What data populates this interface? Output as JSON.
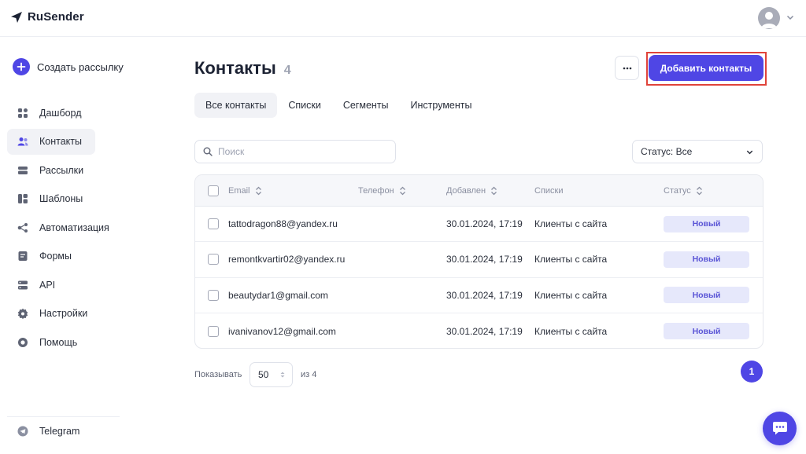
{
  "brand": {
    "name": "RuSender",
    "accent": "#4f46e5"
  },
  "sidebar": {
    "create_label": "Создать рассылку",
    "items": [
      {
        "label": "Дашборд",
        "icon": "dashboard-icon",
        "active": false
      },
      {
        "label": "Контакты",
        "icon": "contacts-icon",
        "active": true
      },
      {
        "label": "Рассылки",
        "icon": "mailings-icon",
        "active": false
      },
      {
        "label": "Шаблоны",
        "icon": "templates-icon",
        "active": false
      },
      {
        "label": "Автоматизация",
        "icon": "automation-icon",
        "active": false
      },
      {
        "label": "Формы",
        "icon": "forms-icon",
        "active": false
      },
      {
        "label": "API",
        "icon": "api-icon",
        "active": false
      },
      {
        "label": "Настройки",
        "icon": "settings-icon",
        "active": false
      },
      {
        "label": "Помощь",
        "icon": "help-icon",
        "active": false
      }
    ],
    "telegram_label": "Telegram"
  },
  "header": {
    "title": "Контакты",
    "count": "4",
    "add_label": "Добавить контакты"
  },
  "tabs": [
    {
      "label": "Все контакты",
      "active": true
    },
    {
      "label": "Списки",
      "active": false
    },
    {
      "label": "Сегменты",
      "active": false
    },
    {
      "label": "Инструменты",
      "active": false
    }
  ],
  "filters": {
    "search_placeholder": "Поиск",
    "status_label": "Статус: Все"
  },
  "table": {
    "columns": {
      "email": "Email",
      "phone": "Телефон",
      "added": "Добавлен",
      "lists": "Списки",
      "status": "Статус"
    },
    "rows": [
      {
        "email": "tattodragon88@yandex.ru",
        "phone": "",
        "added": "30.01.2024, 17:19",
        "lists": "Клиенты с сайта",
        "status": "Новый"
      },
      {
        "email": "remontkvartir02@yandex.ru",
        "phone": "",
        "added": "30.01.2024, 17:19",
        "lists": "Клиенты с сайта",
        "status": "Новый"
      },
      {
        "email": "beautydar1@gmail.com",
        "phone": "",
        "added": "30.01.2024, 17:19",
        "lists": "Клиенты с сайта",
        "status": "Новый"
      },
      {
        "email": "ivanivanov12@gmail.com",
        "phone": "",
        "added": "30.01.2024, 17:19",
        "lists": "Клиенты с сайта",
        "status": "Новый"
      }
    ]
  },
  "pagination": {
    "show_label": "Показывать",
    "per_page": "50",
    "of_label": "из 4",
    "current_page": "1"
  }
}
